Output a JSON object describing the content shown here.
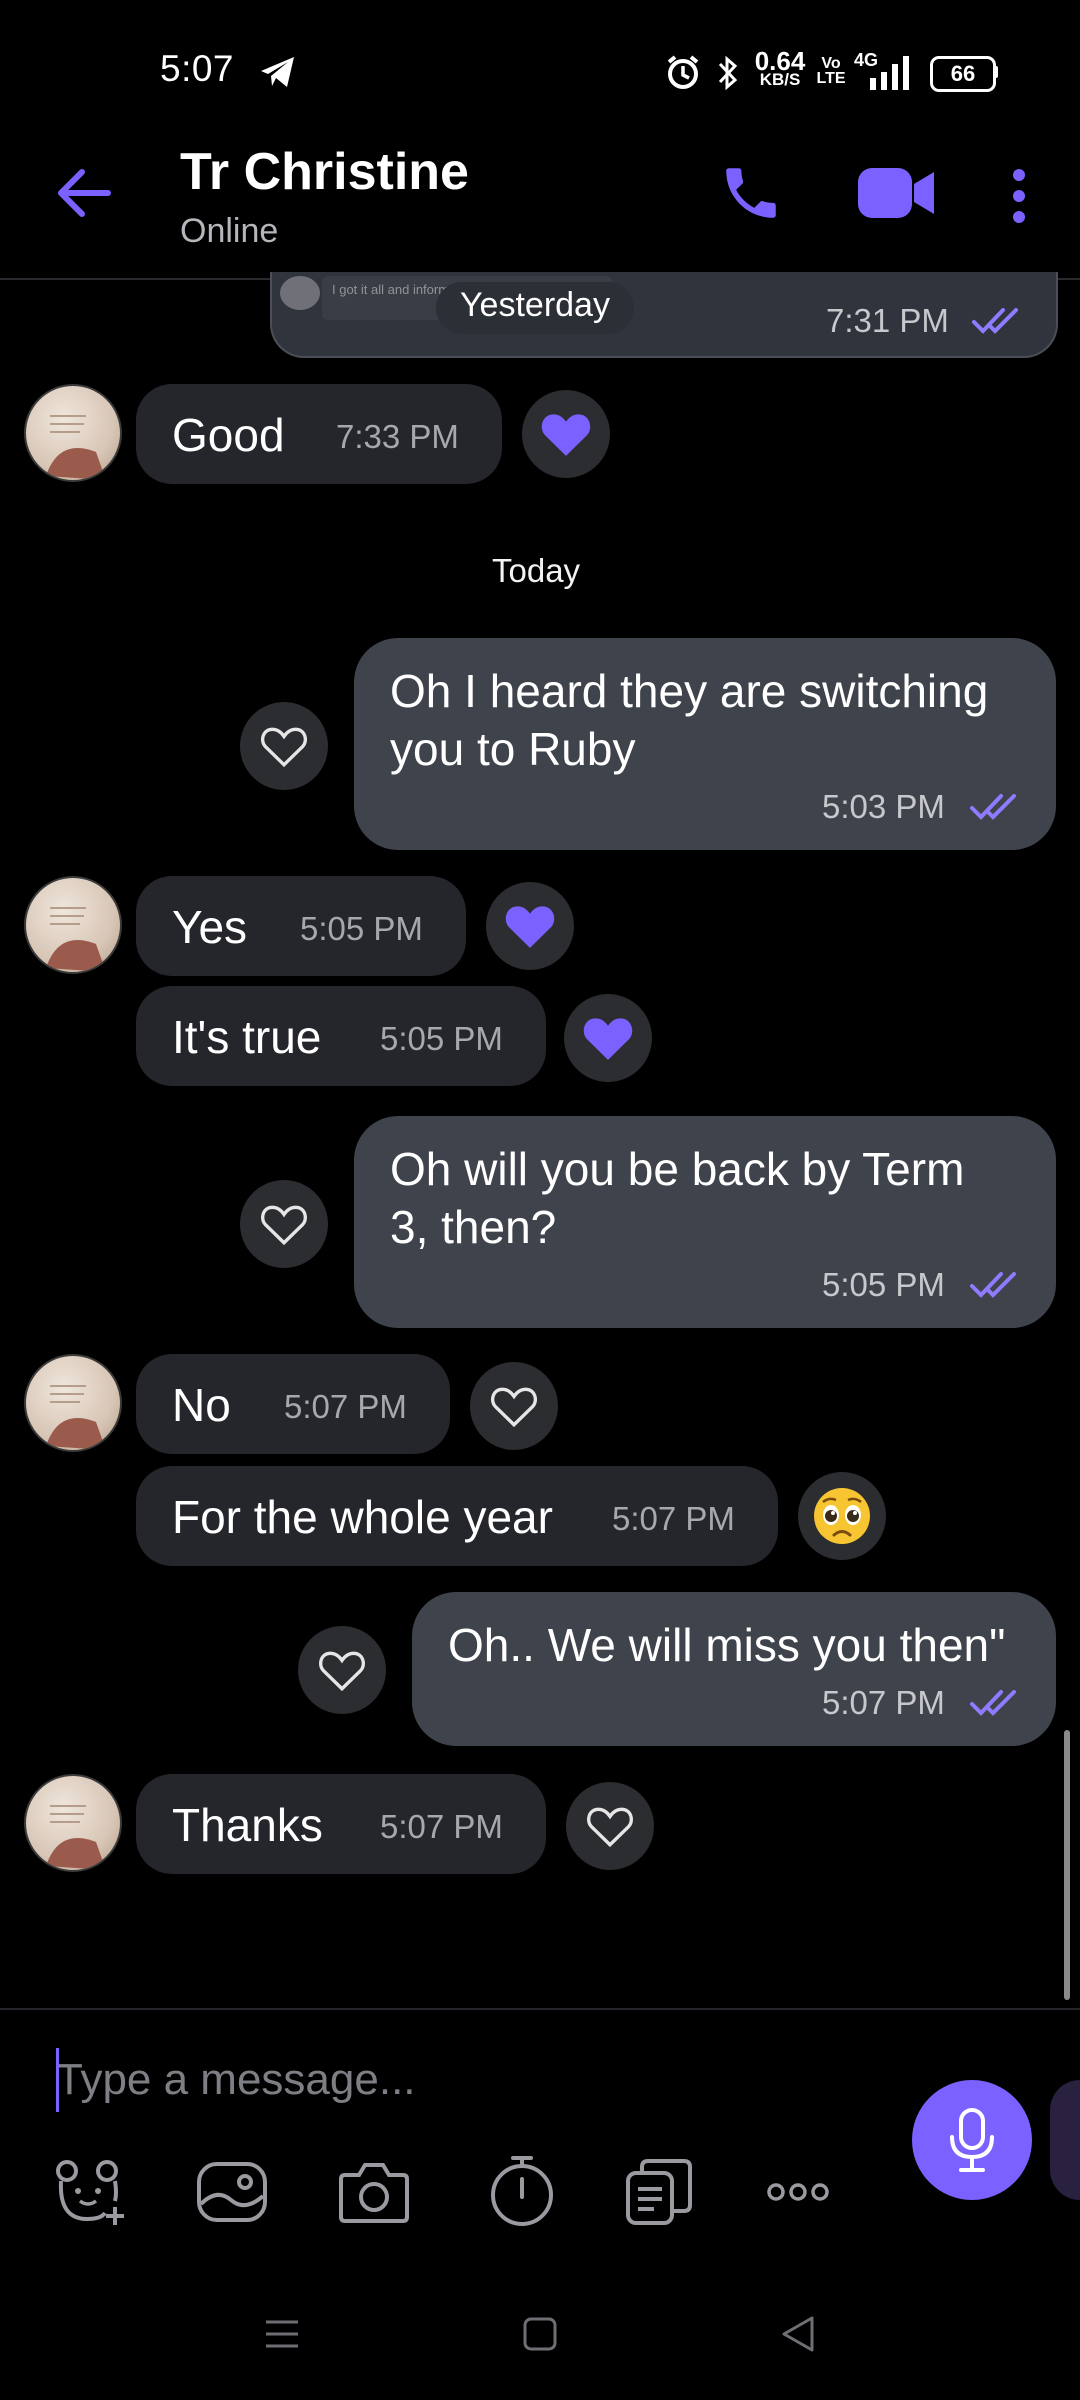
{
  "status_bar": {
    "time": "5:07",
    "net_speed": "0.64",
    "net_unit": "KB/S",
    "volte_top": "Vo",
    "volte_bottom": "LTE",
    "network": "4G",
    "battery": "66"
  },
  "header": {
    "contact_name": "Tr Christine",
    "status": "Online"
  },
  "chat": {
    "prev_date_label": "Yesterday",
    "prev_time": "7:31 PM",
    "prev_snippet": "I got it all and informed the admin, thank you",
    "today_label": "Today",
    "messages": [
      {
        "text": "Good",
        "time": "7:33 PM",
        "reaction": "liked"
      },
      {
        "text": "Oh I heard they are switching you to Ruby",
        "line1": "Oh I heard they are switching",
        "line2": "you to Ruby",
        "time": "5:03 PM",
        "reaction": "none"
      },
      {
        "text": "Yes",
        "time": "5:05 PM",
        "reaction": "liked"
      },
      {
        "text": "It's true",
        "time": "5:05 PM",
        "reaction": "liked"
      },
      {
        "text": "Oh will you be back by Term 3, then?",
        "line1": "Oh will you be back by Term",
        "line2": "3, then?",
        "time": "5:05 PM",
        "reaction": "none"
      },
      {
        "text": "No",
        "time": "5:07 PM",
        "reaction": "none"
      },
      {
        "text": "For the whole year",
        "time": "5:07 PM",
        "reaction": "pleading-face"
      },
      {
        "text": "Oh.. We will miss you then\"",
        "time": "5:07 PM",
        "reaction": "none"
      },
      {
        "text": "Thanks",
        "time": "5:07 PM",
        "reaction": "none"
      }
    ]
  },
  "input": {
    "placeholder": "Type a message..."
  },
  "colors": {
    "accent": "#7b61ff",
    "incoming_bubble": "#25262b",
    "outgoing_bubble": "#3f434b"
  }
}
